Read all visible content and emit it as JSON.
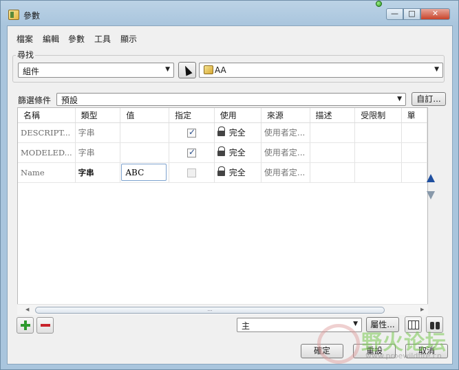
{
  "window": {
    "title": "參數"
  },
  "menu": [
    "檔案",
    "編輯",
    "參數",
    "工具",
    "顯示"
  ],
  "search": {
    "label": "尋找",
    "scope_value": "組件",
    "object_value": "AA"
  },
  "filter": {
    "label": "篩選條件",
    "value": "預設",
    "customize_label": "自訂..."
  },
  "table": {
    "columns": [
      "名稱",
      "類型",
      "值",
      "指定",
      "使用",
      "來源",
      "描述",
      "受限制",
      "單"
    ],
    "rows": [
      {
        "name": "DESCRIPT...",
        "type": "字串",
        "value": "",
        "designate": true,
        "access": "完全",
        "source": "使用者定..."
      },
      {
        "name": "MODELED...",
        "type": "字串",
        "value": "",
        "designate": true,
        "access": "完全",
        "source": "使用者定..."
      },
      {
        "name": "Name",
        "type": "字串",
        "value": "ABC",
        "designate": false,
        "access": "完全",
        "source": "使用者定..."
      }
    ]
  },
  "scrollbar": {
    "grip": "..."
  },
  "bottom": {
    "main_select": "主",
    "properties_label": "屬性..."
  },
  "footer": {
    "ok_label": "確定",
    "reset_label": "重設",
    "cancel_label": "取消"
  },
  "watermark": {
    "text": "野火论坛",
    "url": "www.proewildfire.cn"
  },
  "colors": {
    "move_up_arrow": "#1f4f9f",
    "move_down_arrow": "#8899aa",
    "add": "#2e9a2e",
    "remove": "#c8232a"
  }
}
